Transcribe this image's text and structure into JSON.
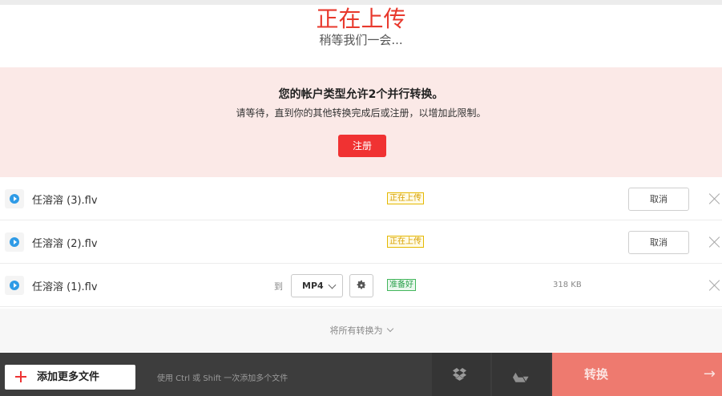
{
  "header": {
    "title": "正在上传",
    "subtitle": "稍等我们一会..."
  },
  "notice": {
    "title": "您的帐户类型允许2个并行转换。",
    "description": "请等待，直到你的其他转换完成后或注册，以增加此限制。",
    "signup_label": "注册"
  },
  "files": [
    {
      "name": "任溶溶 (3).flv",
      "status": "正在上传",
      "action_label": "取消"
    },
    {
      "name": "任溶溶 (2).flv",
      "status": "正在上传",
      "action_label": "取消"
    },
    {
      "name": "任溶溶 (1).flv",
      "to_label": "到",
      "format": "MP4",
      "status": "准备好",
      "size": "318 KB"
    }
  ],
  "convert_all": {
    "label": "将所有转换为"
  },
  "bottom_bar": {
    "add_more_label": "添加更多文件",
    "hint": "使用 Ctrl 或 Shift 一次添加多个文件",
    "convert_label": "转换",
    "icons": [
      "plus-icon",
      "dropbox-icon",
      "google-drive-icon",
      "arrow-right-icon"
    ]
  },
  "colors": {
    "accent": "#e8392d",
    "signup_button": "#f03232",
    "notice_bg": "#fbe9e7",
    "uploading_badge": "#d8a000",
    "ready_badge": "#2aa04b",
    "convert_button": "#ee7a6f",
    "bottom_bar": "#3d3d3d"
  }
}
